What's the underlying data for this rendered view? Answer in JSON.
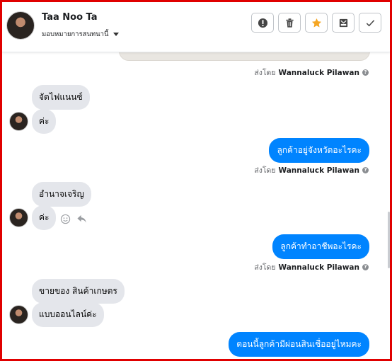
{
  "header": {
    "contact_name": "Taa Noo Ta",
    "assign_label": "มอบหมายการสนทนานี้",
    "buttons": [
      {
        "icon": "alert-icon"
      },
      {
        "icon": "trash-icon"
      },
      {
        "icon": "star-icon",
        "color": "#f5a623"
      },
      {
        "icon": "archive-mail-icon"
      },
      {
        "icon": "check-icon"
      }
    ]
  },
  "sent_by_prefix": "ส่งโดย",
  "agent_name": "Wannaluck Pilawan",
  "messages": [
    {
      "from": "customer",
      "text": "จัดไฟแนนซ์"
    },
    {
      "from": "customer",
      "text": "ค่ะ"
    },
    {
      "from": "page",
      "text": "ลูกค้าอยู่จังหวัดอะไรคะ"
    },
    {
      "from": "customer",
      "text": "อำนาจเจริญ"
    },
    {
      "from": "customer",
      "text": "ค่ะ"
    },
    {
      "from": "page",
      "text": "ลูกค้าทำอาชีพอะไรคะ"
    },
    {
      "from": "customer",
      "text": "ขายของ สินค้าเกษตร"
    },
    {
      "from": "customer",
      "text": "แบบออนไลน์ค่ะ"
    },
    {
      "from": "page",
      "text": "ตอนนี้ลูกค้ามีผ่อนสินเชื่ออยู่ไหมคะ"
    }
  ],
  "colors": {
    "outgoing": "#0084ff",
    "incoming": "#e4e6eb",
    "frame": "#e00000"
  }
}
